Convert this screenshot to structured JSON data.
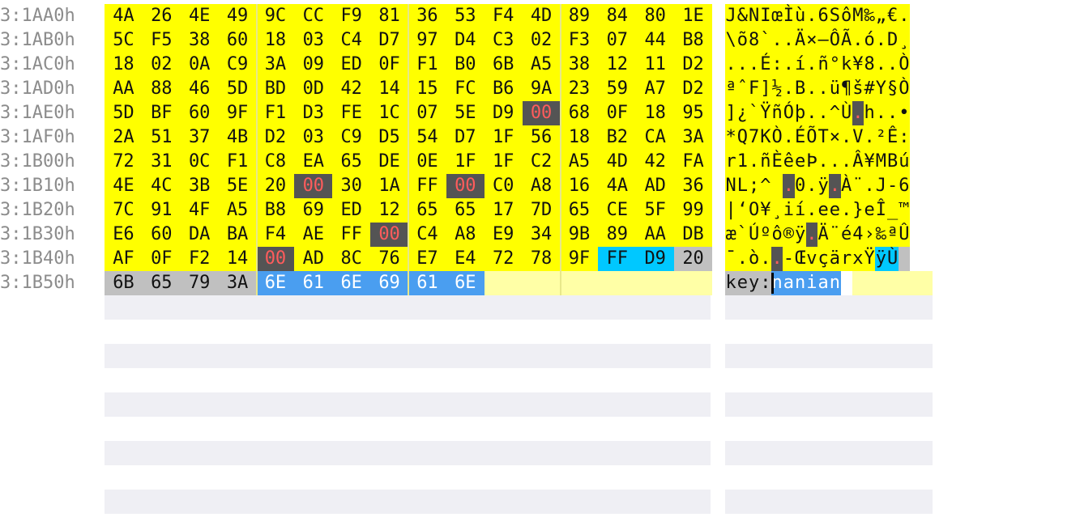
{
  "colors": {
    "file_bg": "#ffff00",
    "pad_bg": "#ffffa6",
    "text_bg": "#c0c0c0",
    "null_bg": "#545454",
    "null_fg": "#ff5c5c",
    "jpeg_marker_bg": "#00c8ff",
    "selection_bg": "#4a9ef0",
    "selection_fg": "#ffffff",
    "offset_fg": "#8c8c8c",
    "empty_row_bg": "#efeff4"
  },
  "offsets": [
    "3:1AA0h",
    "3:1AB0h",
    "3:1AC0h",
    "3:1AD0h",
    "3:1AE0h",
    "3:1AF0h",
    "3:1B00h",
    "3:1B10h",
    "3:1B20h",
    "3:1B30h",
    "3:1B40h",
    "3:1B50h"
  ],
  "rows": [
    {
      "hex": [
        "4A",
        "26",
        "4E",
        "49",
        "9C",
        "CC",
        "F9",
        "81",
        "36",
        "53",
        "F4",
        "4D",
        "89",
        "84",
        "80",
        "1E"
      ],
      "ascii": [
        "J",
        "&",
        "N",
        "I",
        "œ",
        "Ì",
        "ù",
        ".",
        "6",
        "S",
        "ô",
        "M",
        "‰",
        "„",
        "€",
        "."
      ]
    },
    {
      "hex": [
        "5C",
        "F5",
        "38",
        "60",
        "18",
        "03",
        "C4",
        "D7",
        "97",
        "D4",
        "C3",
        "02",
        "F3",
        "07",
        "44",
        "B8"
      ],
      "ascii": [
        "\\",
        "õ",
        "8",
        "`",
        ".",
        ".",
        "Ä",
        "×",
        "—",
        "Ô",
        "Ã",
        ".",
        "ó",
        ".",
        "D",
        "¸"
      ]
    },
    {
      "hex": [
        "18",
        "02",
        "0A",
        "C9",
        "3A",
        "09",
        "ED",
        "0F",
        "F1",
        "B0",
        "6B",
        "A5",
        "38",
        "12",
        "11",
        "D2"
      ],
      "ascii": [
        ".",
        ".",
        ".",
        "É",
        ":",
        ".",
        "í",
        ".",
        "ñ",
        "°",
        "k",
        "¥",
        "8",
        ".",
        ".",
        "Ò"
      ]
    },
    {
      "hex": [
        "AA",
        "88",
        "46",
        "5D",
        "BD",
        "0D",
        "42",
        "14",
        "15",
        "FC",
        "B6",
        "9A",
        "23",
        "59",
        "A7",
        "D2"
      ],
      "ascii": [
        "ª",
        "ˆ",
        "F",
        "]",
        "½",
        ".",
        "B",
        ".",
        ".",
        "ü",
        "¶",
        "š",
        "#",
        "Y",
        "§",
        "Ò"
      ]
    },
    {
      "hex": [
        "5D",
        "BF",
        "60",
        "9F",
        "F1",
        "D3",
        "FE",
        "1C",
        "07",
        "5E",
        "D9",
        "00",
        "68",
        "0F",
        "18",
        "95"
      ],
      "ascii": [
        "]",
        "¿",
        "`",
        "Ÿ",
        "ñ",
        "Ó",
        "þ",
        ".",
        ".",
        "^",
        "Ù",
        ".",
        "h",
        ".",
        ".",
        "•"
      ]
    },
    {
      "hex": [
        "2A",
        "51",
        "37",
        "4B",
        "D2",
        "03",
        "C9",
        "D5",
        "54",
        "D7",
        "1F",
        "56",
        "18",
        "B2",
        "CA",
        "3A"
      ],
      "ascii": [
        "*",
        "Q",
        "7",
        "K",
        "Ò",
        ".",
        "É",
        "Õ",
        "T",
        "×",
        ".",
        "V",
        ".",
        "²",
        "Ê",
        ":"
      ]
    },
    {
      "hex": [
        "72",
        "31",
        "0C",
        "F1",
        "C8",
        "EA",
        "65",
        "DE",
        "0E",
        "1F",
        "1F",
        "C2",
        "A5",
        "4D",
        "42",
        "FA"
      ],
      "ascii": [
        "r",
        "1",
        ".",
        "ñ",
        "È",
        "ê",
        "e",
        "Þ",
        ".",
        ".",
        ".",
        "Â",
        "¥",
        "M",
        "B",
        "ú"
      ]
    },
    {
      "hex": [
        "4E",
        "4C",
        "3B",
        "5E",
        "20",
        "00",
        "30",
        "1A",
        "FF",
        "00",
        "C0",
        "A8",
        "16",
        "4A",
        "AD",
        "36"
      ],
      "ascii": [
        "N",
        "L",
        ";",
        "^",
        " ",
        ".",
        "0",
        ".",
        "ÿ",
        ".",
        "À",
        "¨",
        ".",
        "J",
        "-",
        "6"
      ]
    },
    {
      "hex": [
        "7C",
        "91",
        "4F",
        "A5",
        "B8",
        "69",
        "ED",
        "12",
        "65",
        "65",
        "17",
        "7D",
        "65",
        "CE",
        "5F",
        "99"
      ],
      "ascii": [
        "|",
        "‘",
        "O",
        "¥",
        "¸",
        "i",
        "í",
        ".",
        "e",
        "e",
        ".",
        "}",
        "e",
        "Î",
        "_",
        "™"
      ]
    },
    {
      "hex": [
        "E6",
        "60",
        "DA",
        "BA",
        "F4",
        "AE",
        "FF",
        "00",
        "C4",
        "A8",
        "E9",
        "34",
        "9B",
        "89",
        "AA",
        "DB"
      ],
      "ascii": [
        "æ",
        "`",
        "Ú",
        "º",
        "ô",
        "®",
        "ÿ",
        ".",
        "Ä",
        "¨",
        "é",
        "4",
        "›",
        "‰",
        "ª",
        "Û"
      ]
    },
    {
      "hex": [
        "AF",
        "0F",
        "F2",
        "14",
        "00",
        "AD",
        "8C",
        "76",
        "E7",
        "E4",
        "72",
        "78",
        "9F",
        "FF",
        "D9",
        "20"
      ],
      "ascii": [
        "¯",
        ".",
        "ò",
        ".",
        ".",
        "-",
        "Œ",
        "v",
        "ç",
        "ä",
        "r",
        "x",
        "Ÿ",
        "ÿ",
        "Ù",
        " "
      ]
    },
    {
      "hex": [
        "6B",
        "65",
        "79",
        "3A",
        "6E",
        "61",
        "6E",
        "69",
        "61",
        "6E"
      ],
      "ascii": [
        "k",
        "e",
        "y",
        ":",
        "n",
        "a",
        "n",
        "i",
        "a",
        "n"
      ]
    }
  ]
}
